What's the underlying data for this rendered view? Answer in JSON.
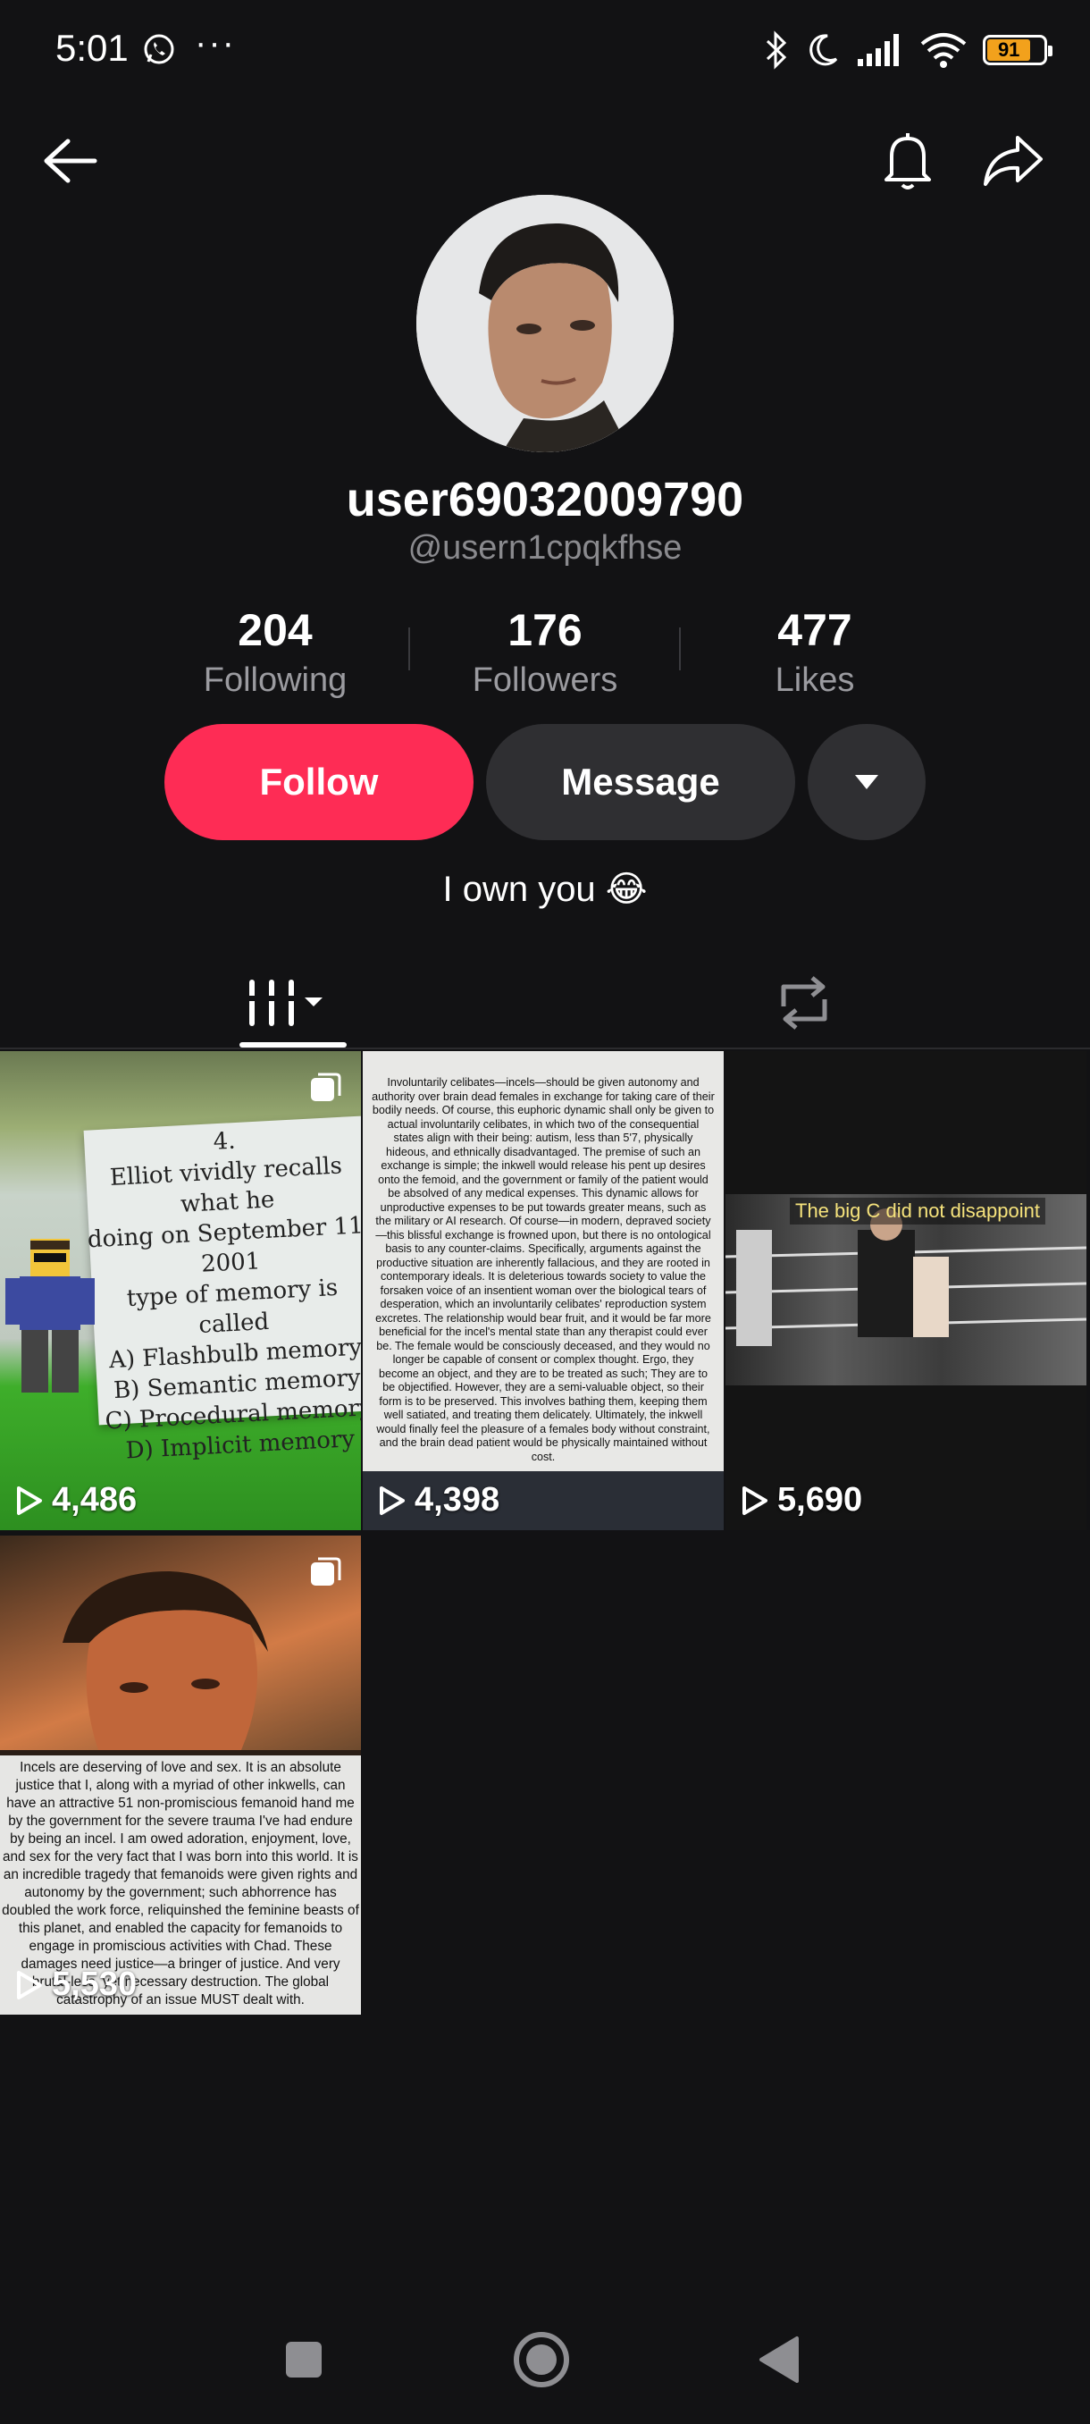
{
  "status_bar": {
    "time": "5:01",
    "more": "···",
    "battery": "91"
  },
  "profile": {
    "username": "user69032009790",
    "handle": "@usern1cpqkfhse",
    "bio": "I own you 😂"
  },
  "stats": [
    {
      "value": "204",
      "label": "Following"
    },
    {
      "value": "176",
      "label": "Followers"
    },
    {
      "value": "477",
      "label": "Likes"
    }
  ],
  "actions": {
    "follow": "Follow",
    "message": "Message"
  },
  "videos": [
    {
      "views": "4,486",
      "thumb_text": "4.\nElliot vividly recalls what he\ndoing on September 11, 2001\ntype of memory is called\nA) Flashbulb memory\nB) Semantic memory\nC) Procedural memory\nD) Implicit memory"
    },
    {
      "views": "4,398",
      "thumb_text": "Involuntarily celibates—incels—should be given autonomy and authority over brain dead females in exchange for taking care of their bodily needs. Of course, this euphoric dynamic shall only be given to actual involuntarily celibates, in which two of the consequential states align with their being: autism, less than 5'7, physically hideous, and ethnically disadvantaged. The premise of such an exchange is simple; the inkwell would release his pent up desires onto the femoid, and the government or family of the patient would be absolved of any medical expenses. This dynamic allows for unproductive expenses to be put towards greater means, such as the military or AI research. Of course—in modern, depraved society—this blissful exchange is frowned upon, but there is no ontological basis to any counter-claims. Specifically, arguments against the productive situation are inherently fallacious, and they are rooted in contemporary ideals. It is deleterious towards society to value the forsaken voice of an insentient woman over the biological tears of desperation, which an involuntarily celibates' reproduction system excretes. The relationship would bear fruit, and it would be far more beneficial for the incel's mental state than any therapist could ever be. The female would be consciously deceased, and they would no longer be capable of consent or complex thought. Ergo, they become an object, and they are to be treated as such; They are to be objectified. However, they are a semi-valuable object, so their form is to be preserved. This involves bathing them, keeping them well satiated, and treating them delicately. Ultimately, the inkwell would finally feel the pleasure of a females body without constraint, and the brain dead patient would be physically maintained without cost."
    },
    {
      "views": "5,690",
      "caption": "The big C did not disappoint"
    },
    {
      "views": "5,530",
      "thumb_text": "Incels are deserving of love and sex. It is an absolute justice that I, along with a myriad of other inkwells, can have an attractive 51 non-promiscious femanoid hand me by the government for the severe trauma I've had endure by being an incel. I am owed adoration, enjoyment, love, and sex for the very fact that I was born into this world. It is an incredible tragedy that femanoids were given rights and autonomy by the government; such abhorrence has doubled the work force, reliquinshed the feminine beasts of this planet, and enabled the capacity for femanoids to engage in promiscious activities with Chad. These damages need justice—a bringer of justice. And very brutal-less, yet necessary destruction. The global catastrophy of an issue MUST dealt with."
    }
  ]
}
